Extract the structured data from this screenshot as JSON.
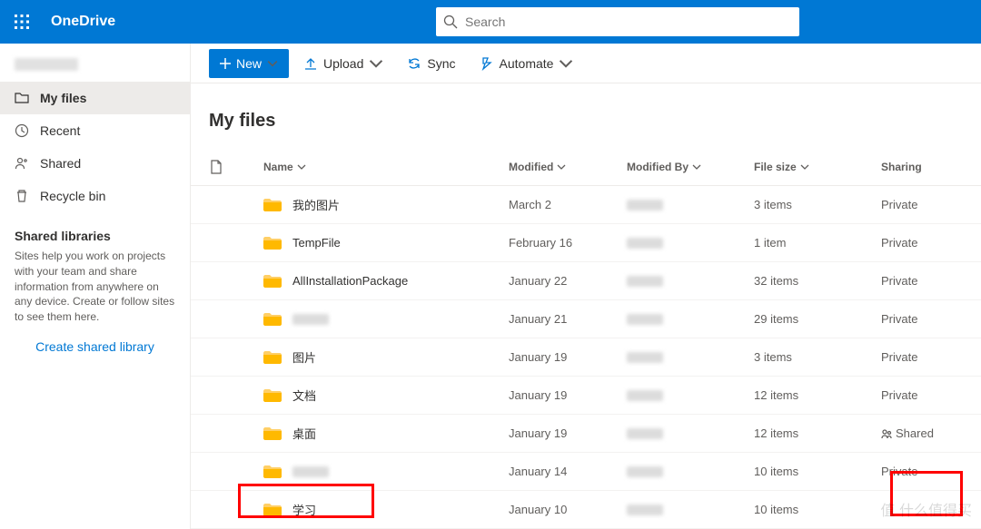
{
  "header": {
    "brand": "OneDrive",
    "search_placeholder": "Search"
  },
  "sidebar": {
    "items": [
      {
        "label": "My files"
      },
      {
        "label": "Recent"
      },
      {
        "label": "Shared"
      },
      {
        "label": "Recycle bin"
      }
    ],
    "shared_libraries_title": "Shared libraries",
    "shared_libraries_desc": "Sites help you work on projects with your team and share information from anywhere on any device. Create or follow sites to see them here.",
    "create_link": "Create shared library"
  },
  "toolbar": {
    "new_label": "New",
    "upload_label": "Upload",
    "sync_label": "Sync",
    "automate_label": "Automate"
  },
  "page": {
    "title": "My files"
  },
  "columns": {
    "name": "Name",
    "modified": "Modified",
    "modified_by": "Modified By",
    "file_size": "File size",
    "sharing": "Sharing"
  },
  "rows": [
    {
      "name": "我的图片",
      "modified": "March 2",
      "file_size": "3 items",
      "sharing": "Private"
    },
    {
      "name": "TempFile",
      "modified": "February 16",
      "file_size": "1 item",
      "sharing": "Private"
    },
    {
      "name": "AllInstallationPackage",
      "modified": "January 22",
      "file_size": "32 items",
      "sharing": "Private"
    },
    {
      "name": "",
      "modified": "January 21",
      "file_size": "29 items",
      "sharing": "Private",
      "blur_name": true
    },
    {
      "name": "图片",
      "modified": "January 19",
      "file_size": "3 items",
      "sharing": "Private"
    },
    {
      "name": "文档",
      "modified": "January 19",
      "file_size": "12 items",
      "sharing": "Private"
    },
    {
      "name": "桌面",
      "modified": "January 19",
      "file_size": "12 items",
      "sharing": "Shared",
      "shared_icon": true
    },
    {
      "name": "",
      "modified": "January 14",
      "file_size": "10 items",
      "sharing": "Private",
      "blur_name": true
    },
    {
      "name": "学习",
      "modified": "January 10",
      "file_size": "10 items",
      "sharing": ""
    }
  ]
}
